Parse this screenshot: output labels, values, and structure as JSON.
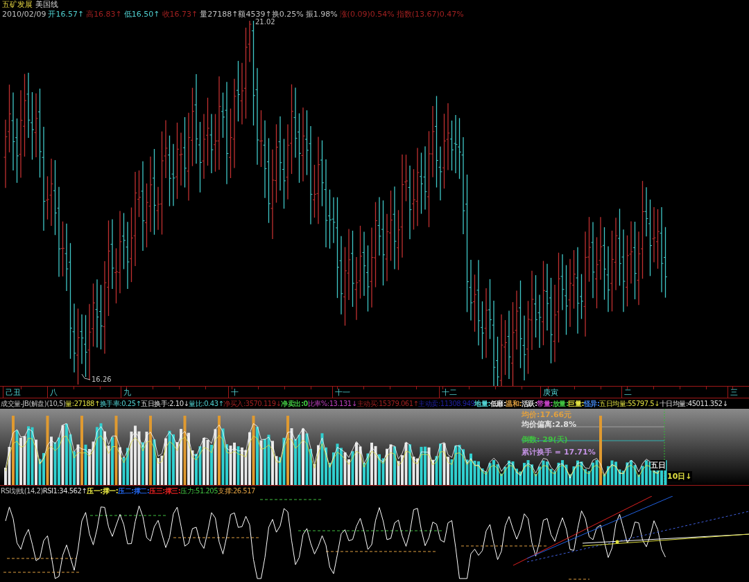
{
  "header": {
    "stock_name": "五矿发展",
    "chart_type": "美国线"
  },
  "quote": [
    {
      "text": "2010/02/09",
      "color": "#c0c0c0"
    },
    {
      "text": "开16.57↑",
      "color": "#50d0d0"
    },
    {
      "text": "高16.83↑",
      "color": "#a02020"
    },
    {
      "text": "低16.50↑",
      "color": "#50d0d0"
    },
    {
      "text": "收16.73↑",
      "color": "#a02020"
    },
    {
      "text": "量27188↑额4539↑换0.25%",
      "color": "#c0c0c0"
    },
    {
      "text": "振1.98%",
      "color": "#c0c0c0"
    },
    {
      "text": "涨(0.09)0.54%",
      "color": "#a02020"
    },
    {
      "text": "指数(13.67)0.47%",
      "color": "#a02020"
    }
  ],
  "price_chart": {
    "high_label": "21.02",
    "low_label": "16.26"
  },
  "time_axis": [
    "己丑",
    "八",
    "九",
    "十",
    "十一",
    "十二",
    "庚寅",
    "二",
    "三"
  ],
  "volume_header": [
    {
      "text": "成交量-JB(解盘)(10,5)",
      "color": "#c0c0c0"
    },
    {
      "text": "量:27188↑",
      "color": "#e0e040"
    },
    {
      "text": "换手率:0.25↑",
      "color": "#50d0d0"
    },
    {
      "text": "五日换手:2.10↓",
      "color": "#e0e0e0"
    },
    {
      "text": "量比:0.43↑",
      "color": "#50d0d0"
    },
    {
      "text": "净买入:3570.119↓",
      "color": "#a02020"
    },
    {
      "text": "净卖出:0",
      "color": "#40c040"
    },
    {
      "text": "比率%:13.131↓",
      "color": "#c040c0"
    },
    {
      "text": "主动买:15379.061↑",
      "color": "#a02020"
    },
    {
      "text": "主动卖:11308.949",
      "color": "#2020a0"
    },
    {
      "text": "地量:",
      "color": "#50d0d0"
    },
    {
      "text": "低靡:",
      "color": "#e0e0e0"
    },
    {
      "text": "温和:",
      "color": "#e0a040"
    },
    {
      "text": "活跃:",
      "color": "#e0e0e0"
    },
    {
      "text": "带量:",
      "color": "#c040c0"
    },
    {
      "text": "放量:",
      "color": "#40c040"
    },
    {
      "text": "巨量:",
      "color": "#e0e040"
    },
    {
      "text": "怪异:",
      "color": "#4080e0"
    },
    {
      "text": "五日均量:55797.5↓",
      "color": "#e0e040"
    },
    {
      "text": "十日均量:45011.352↓",
      "color": "#e0e0e0"
    }
  ],
  "volume_overlay": [
    {
      "text": "均价:17.66元",
      "color": "#e0a040"
    },
    {
      "text": "均价偏离:2.8%",
      "color": "#e0e0e0"
    },
    {
      "text": "倒数: 29(天)",
      "color": "#40c040"
    },
    {
      "text": "累计换手 = 17.71%",
      "color": "#c090e0"
    }
  ],
  "volume_legend": {
    "five_day": "五日",
    "ten_day": "10日↓"
  },
  "rsi_header": [
    {
      "text": "RSI划线(14,2)",
      "color": "#c0c0c0"
    },
    {
      "text": "RSI1:34.562↑",
      "color": "#e0e0e0"
    },
    {
      "text": "压一:",
      "color": "#e0e040"
    },
    {
      "text": "撑一:",
      "color": "#e0e040"
    },
    {
      "text": "压二:",
      "color": "#2060e0"
    },
    {
      "text": "撑二:",
      "color": "#2060e0"
    },
    {
      "text": "压三:",
      "color": "#e02020"
    },
    {
      "text": "撑三:",
      "color": "#e02020"
    },
    {
      "text": "压力:51.205",
      "color": "#40c040"
    },
    {
      "text": "支撑:26.517",
      "color": "#e0a040"
    }
  ]
}
